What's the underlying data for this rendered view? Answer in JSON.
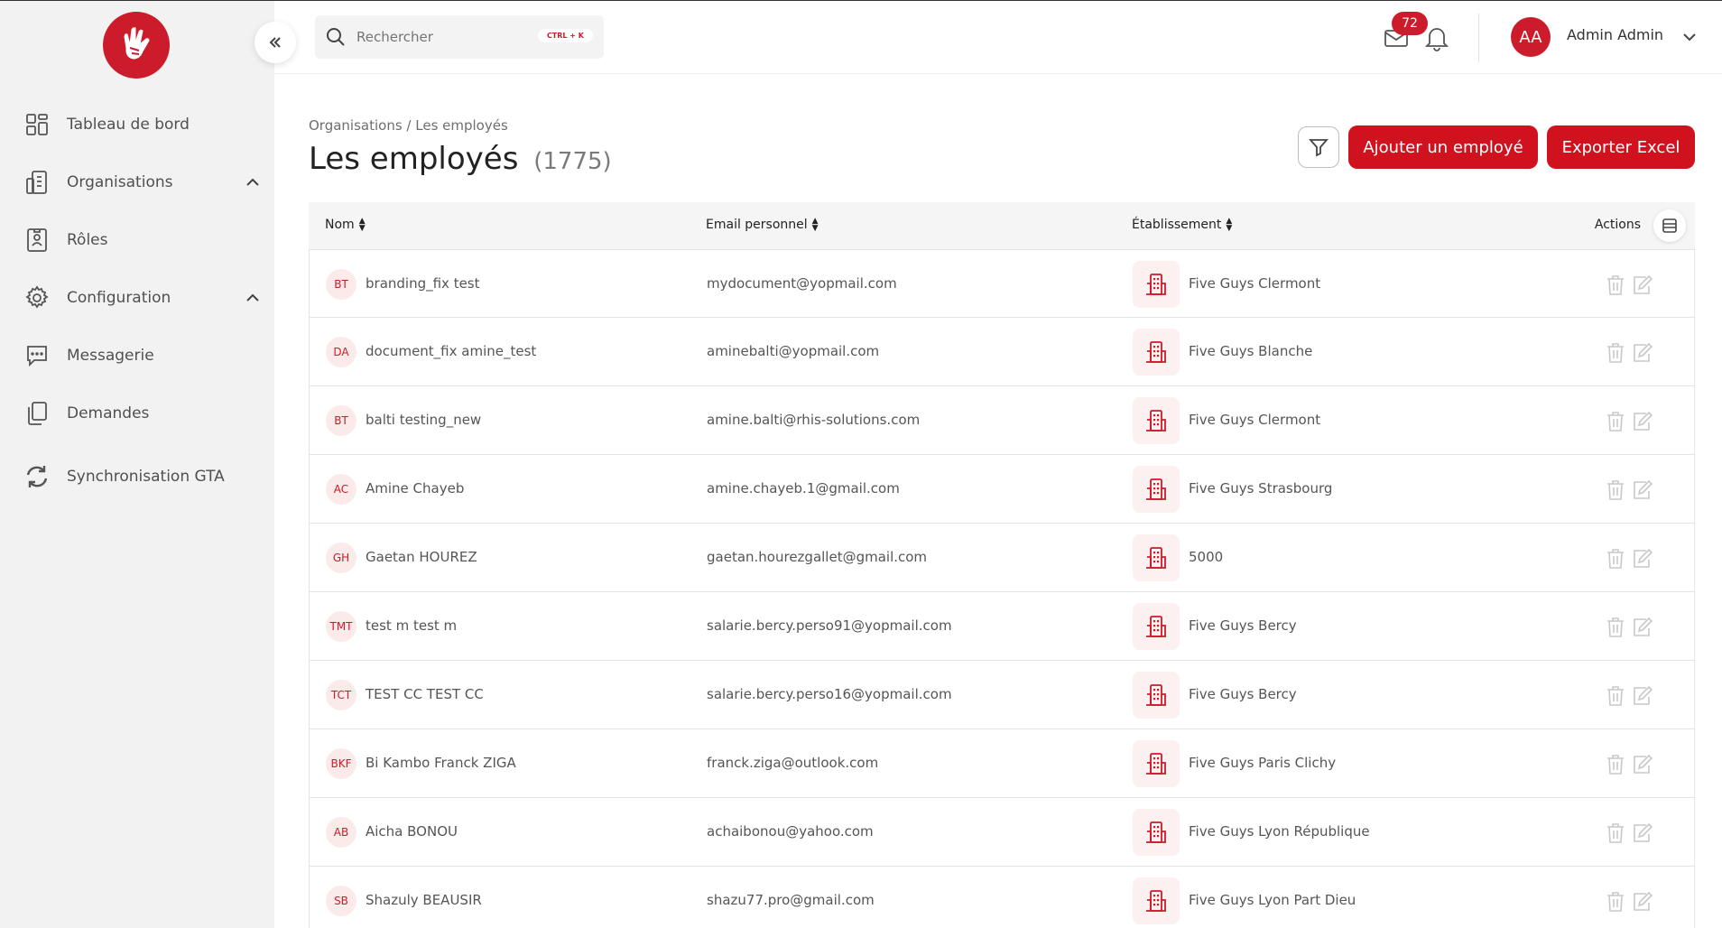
{
  "sidebar": {
    "items": [
      {
        "label": "Tableau de bord",
        "icon": "dashboard-icon"
      },
      {
        "label": "Organisations",
        "icon": "building-icon"
      },
      {
        "label": "Rôles",
        "icon": "role-badge-icon"
      },
      {
        "label": "Configuration",
        "icon": "gear-icon"
      },
      {
        "label": "Messagerie",
        "icon": "chat-icon"
      },
      {
        "label": "Demandes",
        "icon": "documents-icon"
      },
      {
        "label": "Synchronisation GTA",
        "icon": "sync-icon"
      }
    ]
  },
  "header": {
    "search_placeholder": "Rechercher",
    "search_shortcut": "CTRL + K",
    "mail_count": "72",
    "user_initials": "AA",
    "user_name": "Admin Admin"
  },
  "page": {
    "breadcrumb": "Organisations / Les employés",
    "title": "Les employés",
    "count": "(1775)",
    "add_button": "Ajouter un employé",
    "export_button": "Exporter Excel"
  },
  "table": {
    "columns": {
      "name": "Nom",
      "email": "Email personnel",
      "establishment": "Établissement",
      "actions": "Actions"
    },
    "rows": [
      {
        "initials": "BT",
        "name": "branding_fix test",
        "email": "mydocument@yopmail.com",
        "establishment": "Five Guys Clermont"
      },
      {
        "initials": "DA",
        "name": "document_fix amine_test",
        "email": "aminebalti@yopmail.com",
        "establishment": "Five Guys Blanche"
      },
      {
        "initials": "BT",
        "name": "balti testing_new",
        "email": "amine.balti@rhis-solutions.com",
        "establishment": "Five Guys Clermont"
      },
      {
        "initials": "AC",
        "name": "Amine Chayeb",
        "email": "amine.chayeb.1@gmail.com",
        "establishment": "Five Guys Strasbourg"
      },
      {
        "initials": "GH",
        "name": "Gaetan HOUREZ",
        "email": "gaetan.hourezgallet@gmail.com",
        "establishment": "5000"
      },
      {
        "initials": "TMT",
        "name": "test m test m",
        "email": "salarie.bercy.perso91@yopmail.com",
        "establishment": "Five Guys Bercy"
      },
      {
        "initials": "TCT",
        "name": "TEST CC TEST CC",
        "email": "salarie.bercy.perso16@yopmail.com",
        "establishment": "Five Guys Bercy"
      },
      {
        "initials": "BKF",
        "name": "Bi Kambo Franck ZIGA",
        "email": "franck.ziga@outlook.com",
        "establishment": "Five Guys Paris Clichy"
      },
      {
        "initials": "AB",
        "name": "Aicha BONOU",
        "email": "achaibonou@yahoo.com",
        "establishment": "Five Guys Lyon République"
      },
      {
        "initials": "SB",
        "name": "Shazuly BEAUSIR",
        "email": "shazu77.pro@gmail.com",
        "establishment": "Five Guys Lyon Part Dieu"
      }
    ]
  },
  "colors": {
    "accent": "#cc1b2b",
    "sidebar_bg": "#f2f2f2"
  }
}
